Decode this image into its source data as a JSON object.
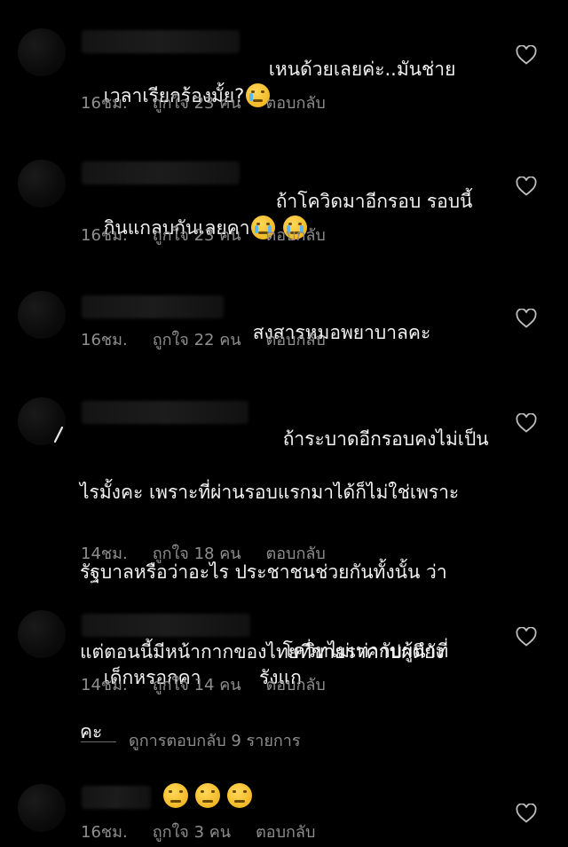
{
  "comments": [
    {
      "text": "เหนด้วยเลยค่ะ..มันช่าย\nเวลาเรียกร้องมั้ย?",
      "emojis": [
        "crying-face-emoji"
      ],
      "time": "16ชม.",
      "likes": "ถูกใจ 23 คน",
      "reply": "ตอบกลับ"
    },
    {
      "text": "ถ้าโควิดมาอีกรอบ รอบนี้\nกินแกลบกันเลยคา",
      "emojis": [
        "loudly-crying-face-emoji",
        "loudly-crying-face-emoji"
      ],
      "time": "16ชม.",
      "likes": "ถูกใจ 23 คน",
      "reply": "ตอบกลับ"
    },
    {
      "text": "สงสารหมอพยาบาลคะ",
      "emojis": [],
      "time": "16ชม.",
      "likes": "ถูกใจ 22 คน",
      "reply": "ตอบกลับ"
    },
    {
      "text": "ถ้าระบาดอีกรอบคงไม่เป็น\nไรมั้งคะ เพราะที่ผ่านรอบแรกมาได้ก็ไม่ใช่เพราะ\nรัฐบาลหรือว่าอะไร ประชาชนช่วยกันทั้งนั้น ว่า\nแต่ตอนนี้มีหน้ากากของไทยที่ขายราคาปกติยัง\nคะ",
      "emojis": [],
      "time": "14ชม.",
      "likes": "ถูกใจ 18 คน",
      "reply": "ตอบกลับ"
    },
    {
      "text": "โควิทไม่เท่ากับผู้นำที่รังแก\nเด็กหรอกคา",
      "emojis": [],
      "time": "14ชม.",
      "likes": "ถูกใจ 14 คน",
      "reply": "ตอบกลับ"
    },
    {
      "text": "",
      "emojis": [
        "expressionless-face-emoji",
        "confounded-face-emoji",
        "disappointed-face-emoji"
      ],
      "time": "16ชม.",
      "likes": "ถูกใจ 3 คน",
      "reply": "ตอบกลับ"
    }
  ],
  "view_replies": {
    "label": "ดูการตอบกลับ 9 รายการ"
  },
  "colors": {
    "background": "#000000",
    "text": "#f2f2f2",
    "meta": "#8e8e8e"
  },
  "icons": {
    "like": "heart-outline-icon"
  }
}
